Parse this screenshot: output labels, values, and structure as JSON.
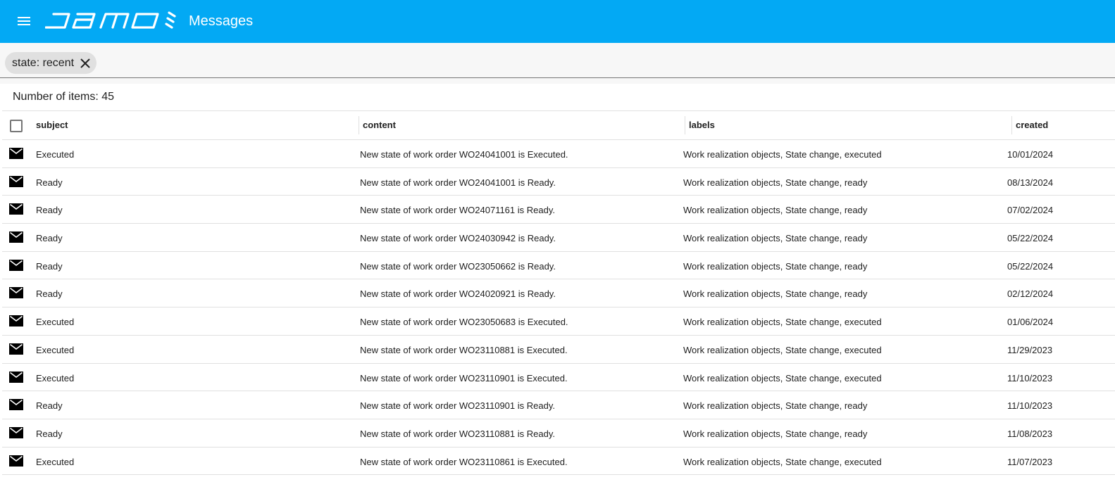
{
  "header": {
    "menu_icon": "hamburger-menu-icon",
    "logo_text": "samo",
    "title": "Messages",
    "background": "#03a9f4"
  },
  "filter": {
    "chip_label": "state: recent",
    "chip_close_icon": "close-icon"
  },
  "list": {
    "count_label": "Number of items: 45",
    "columns": {
      "subject": "subject",
      "content": "content",
      "labels": "labels",
      "created": "created"
    },
    "row_icon": "envelope-icon",
    "rows": [
      {
        "subject": "Executed",
        "content": "New state of work order WO24041001 is Executed.",
        "labels": "Work realization objects, State change, executed",
        "created": "10/01/2024"
      },
      {
        "subject": "Ready",
        "content": "New state of work order WO24041001 is Ready.",
        "labels": "Work realization objects, State change, ready",
        "created": "08/13/2024"
      },
      {
        "subject": "Ready",
        "content": "New state of work order WO24071161 is Ready.",
        "labels": "Work realization objects, State change, ready",
        "created": "07/02/2024"
      },
      {
        "subject": "Ready",
        "content": "New state of work order WO24030942 is Ready.",
        "labels": "Work realization objects, State change, ready",
        "created": "05/22/2024"
      },
      {
        "subject": "Ready",
        "content": "New state of work order WO23050662 is Ready.",
        "labels": "Work realization objects, State change, ready",
        "created": "05/22/2024"
      },
      {
        "subject": "Ready",
        "content": "New state of work order WO24020921 is Ready.",
        "labels": "Work realization objects, State change, ready",
        "created": "02/12/2024"
      },
      {
        "subject": "Executed",
        "content": "New state of work order WO23050683 is Executed.",
        "labels": "Work realization objects, State change, executed",
        "created": "01/06/2024"
      },
      {
        "subject": "Executed",
        "content": "New state of work order WO23110881 is Executed.",
        "labels": "Work realization objects, State change, executed",
        "created": "11/29/2023"
      },
      {
        "subject": "Executed",
        "content": "New state of work order WO23110901 is Executed.",
        "labels": "Work realization objects, State change, executed",
        "created": "11/10/2023"
      },
      {
        "subject": "Ready",
        "content": "New state of work order WO23110901 is Ready.",
        "labels": "Work realization objects, State change, ready",
        "created": "11/10/2023"
      },
      {
        "subject": "Ready",
        "content": "New state of work order WO23110881 is Ready.",
        "labels": "Work realization objects, State change, ready",
        "created": "11/08/2023"
      },
      {
        "subject": "Executed",
        "content": "New state of work order WO23110861 is Executed.",
        "labels": "Work realization objects, State change, executed",
        "created": "11/07/2023"
      }
    ]
  }
}
